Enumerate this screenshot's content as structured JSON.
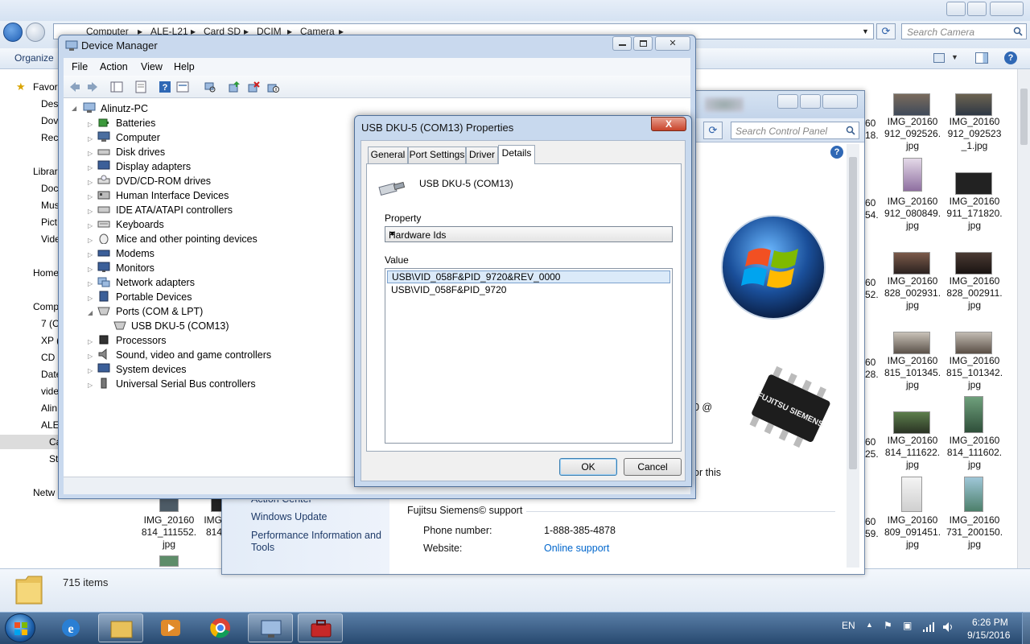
{
  "explorer": {
    "breadcrumb": [
      "Computer",
      "ALE-L21",
      "Card SD",
      "DCIM",
      "Camera"
    ],
    "search_placeholder": "Search Camera",
    "toolbar": {
      "organize": "Organize"
    },
    "nav": [
      "Favor",
      "Des",
      "Dov",
      "Rec",
      "Librar",
      "Doc",
      "Mus",
      "Pict",
      "Vide",
      "Home",
      "Comp",
      "7 (C",
      "XP (",
      "CD",
      "Date",
      "vide",
      "Alin",
      "ALE",
      "Ca",
      "St",
      "Netw"
    ],
    "status": {
      "count": "715 items"
    },
    "thumbs": [
      {
        "line1": "IMG_20160",
        "line2": "912_092526.",
        "line3": "jpg"
      },
      {
        "line1": "IMG_20160",
        "line2": "912_092523",
        "line3": "_1.jpg"
      },
      {
        "line1": "IMG_20160",
        "line2": "912_080849.",
        "line3": "jpg"
      },
      {
        "line1": "IMG_20160",
        "line2": "911_171820.",
        "line3": "jpg"
      },
      {
        "line1": "IMG_20160",
        "line2": "828_002931.",
        "line3": "jpg"
      },
      {
        "line1": "IMG_20160",
        "line2": "828_002911.",
        "line3": "jpg"
      },
      {
        "line1": "IMG_20160",
        "line2": "815_101345.",
        "line3": "jpg"
      },
      {
        "line1": "IMG_20160",
        "line2": "815_101342.",
        "line3": "jpg"
      },
      {
        "line1": "IMG_20160",
        "line2": "814_111622.",
        "line3": "jpg"
      },
      {
        "line1": "IMG_20160",
        "line2": "814_111602.",
        "line3": "jpg"
      },
      {
        "line1": "IMG_20160",
        "line2": "809_091451.",
        "line3": "jpg"
      },
      {
        "line1": "IMG_20160",
        "line2": "731_200150.",
        "line3": "jpg"
      },
      {
        "line1": "IMG_20160",
        "line2": "814_111552.",
        "line3": "jpg"
      },
      {
        "line1": "IMG",
        "line2": "814",
        "line3": ""
      }
    ],
    "cut_numbers": [
      "60",
      "18.",
      "60",
      "54.",
      "60",
      "52.",
      "60",
      "28.",
      "60",
      "25.",
      "60",
      "59."
    ]
  },
  "control_panel": {
    "search_placeholder": "Search Control Panel",
    "links": [
      "Action Center",
      "Windows Update",
      "Performance Information and",
      "Tools"
    ],
    "support": {
      "heading": "Fujitsu Siemens© support",
      "phone_label": "Phone number:",
      "phone_value": "1-888-385-4878",
      "website_label": "Website:",
      "website_value": "Online support"
    },
    "fragments": {
      "at": "0 @",
      "for_this": "or this"
    },
    "chip_brand": "FUJITSU SIEMENS"
  },
  "device_manager": {
    "title": "Device Manager",
    "menu": [
      "File",
      "Action",
      "View",
      "Help"
    ],
    "root": "Alinutz-PC",
    "categories": [
      "Batteries",
      "Computer",
      "Disk drives",
      "Display adapters",
      "DVD/CD-ROM drives",
      "Human Interface Devices",
      "IDE ATA/ATAPI controllers",
      "Keyboards",
      "Mice and other pointing devices",
      "Modems",
      "Monitors",
      "Network adapters",
      "Portable Devices",
      "Ports (COM & LPT)",
      "USB DKU-5 (COM13)",
      "Processors",
      "Sound, video and game controllers",
      "System devices",
      "Universal Serial Bus controllers"
    ]
  },
  "properties": {
    "title": "USB DKU-5 (COM13) Properties",
    "close": "X",
    "tabs": [
      "General",
      "Port Settings",
      "Driver",
      "Details"
    ],
    "active_tab": "Details",
    "device_name": "USB DKU-5 (COM13)",
    "property_label": "Property",
    "property_value": "Hardware Ids",
    "value_label": "Value",
    "values": [
      "USB\\VID_058F&PID_9720&REV_0000",
      "USB\\VID_058F&PID_9720"
    ],
    "ok": "OK",
    "cancel": "Cancel"
  },
  "taskbar": {
    "lang": "EN",
    "time": "6:26 PM",
    "date": "9/15/2016"
  },
  "colors": {
    "accent": "#2b5fa8",
    "link": "#0066cc",
    "selection": "#dbeaf9"
  }
}
